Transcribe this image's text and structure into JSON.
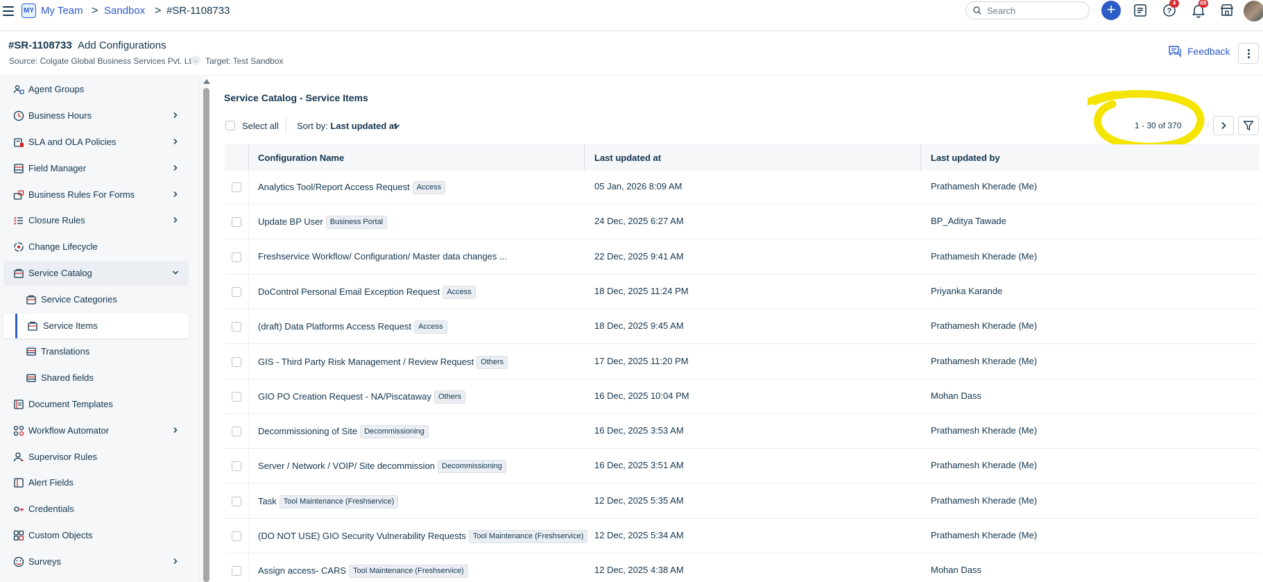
{
  "topbar": {
    "workspace_badge": "MY",
    "breadcrumbs": [
      "My Team",
      "Sandbox",
      "#SR-1108733"
    ],
    "breadcrumb_separator": ">",
    "search_placeholder": "Search",
    "plus_label": "+",
    "help_badge": "4",
    "notifications_badge": "69"
  },
  "subheader": {
    "id": "#SR-1108733",
    "dot": "·",
    "title": "Add Configurations",
    "source": "Source: Colgate Global Business Services Pvt. Ltd.",
    "arrow": "→",
    "target": "Target: Test Sandbox",
    "feedback_label": "Feedback"
  },
  "sidebar": {
    "items": [
      {
        "label": "Agent Groups",
        "icon": "agent-groups-icon",
        "has_chevron": false
      },
      {
        "label": "Business Hours",
        "icon": "clock-icon",
        "has_chevron": true
      },
      {
        "label": "SLA and OLA Policies",
        "icon": "sla-icon",
        "has_chevron": true
      },
      {
        "label": "Field Manager",
        "icon": "field-manager-icon",
        "has_chevron": true
      },
      {
        "label": "Business Rules For Forms",
        "icon": "business-rules-icon",
        "has_chevron": true
      },
      {
        "label": "Closure Rules",
        "icon": "closure-rules-icon",
        "has_chevron": true
      },
      {
        "label": "Change Lifecycle",
        "icon": "change-lifecycle-icon",
        "has_chevron": false
      },
      {
        "label": "Service Catalog",
        "icon": "service-catalog-icon",
        "has_chevron": true,
        "expanded": true
      },
      {
        "label": "Service Categories",
        "icon": "service-categories-icon",
        "has_chevron": false,
        "child": true
      },
      {
        "label": "Service Items",
        "icon": "service-items-icon",
        "has_chevron": false,
        "child": true,
        "active": true
      },
      {
        "label": "Translations",
        "icon": "translations-icon",
        "has_chevron": false,
        "child": true
      },
      {
        "label": "Shared fields",
        "icon": "shared-fields-icon",
        "has_chevron": false,
        "child": true
      },
      {
        "label": "Document Templates",
        "icon": "document-templates-icon",
        "has_chevron": false
      },
      {
        "label": "Workflow Automator",
        "icon": "workflow-icon",
        "has_chevron": true
      },
      {
        "label": "Supervisor Rules",
        "icon": "supervisor-rules-icon",
        "has_chevron": false
      },
      {
        "label": "Alert Fields",
        "icon": "alert-fields-icon",
        "has_chevron": false
      },
      {
        "label": "Credentials",
        "icon": "credentials-icon",
        "has_chevron": false
      },
      {
        "label": "Custom Objects",
        "icon": "custom-objects-icon",
        "has_chevron": false
      },
      {
        "label": "Surveys",
        "icon": "surveys-icon",
        "has_chevron": true
      }
    ]
  },
  "main": {
    "title": "Service Catalog - Service Items",
    "select_all_label": "Select all",
    "sort_prefix": "Sort by:",
    "sort_value": "Last updated at",
    "pagination": "1 - 30 of 370",
    "prev_label": "‹",
    "columns": [
      "Configuration Name",
      "Last updated at",
      "Last updated by"
    ],
    "rows": [
      {
        "name": "Analytics Tool/Report Access Request",
        "tag": "Access",
        "updated_at": "05 Jan, 2026 8:09 AM",
        "updated_by": "Prathamesh Kherade (Me)"
      },
      {
        "name": "Update BP User",
        "tag": "Business Portal",
        "updated_at": "24 Dec, 2025 6:27 AM",
        "updated_by": "BP_Aditya Tawade"
      },
      {
        "name": "Freshservice Workflow/ Configuration/ Master data changes ...",
        "tag": "",
        "updated_at": "22 Dec, 2025 9:41 AM",
        "updated_by": "Prathamesh Kherade (Me)"
      },
      {
        "name": "DoControl Personal Email Exception Request",
        "tag": "Access",
        "updated_at": "18 Dec, 2025 11:24 PM",
        "updated_by": "Priyanka Karande"
      },
      {
        "name": "(draft) Data Platforms Access Request",
        "tag": "Access",
        "updated_at": "18 Dec, 2025 9:45 AM",
        "updated_by": "Prathamesh Kherade (Me)"
      },
      {
        "name": "GIS - Third Party Risk Management / Review Request",
        "tag": "Others",
        "updated_at": "17 Dec, 2025 11:20 PM",
        "updated_by": "Prathamesh Kherade (Me)"
      },
      {
        "name": "GIO PO Creation Request - NA/Piscataway",
        "tag": "Others",
        "updated_at": "16 Dec, 2025 10:04 PM",
        "updated_by": "Mohan Dass"
      },
      {
        "name": "Decommissioning of Site",
        "tag": "Decommissioning",
        "updated_at": "16 Dec, 2025 3:53 AM",
        "updated_by": "Prathamesh Kherade (Me)"
      },
      {
        "name": "Server / Network / VOIP/ Site decommission",
        "tag": "Decommissioning",
        "updated_at": "16 Dec, 2025 3:51 AM",
        "updated_by": "Prathamesh Kherade (Me)"
      },
      {
        "name": "Task",
        "tag": "Tool Maintenance (Freshservice)",
        "updated_at": "12 Dec, 2025 5:35 AM",
        "updated_by": "Prathamesh Kherade (Me)"
      },
      {
        "name": "(DO NOT USE) GIO Security Vulnerability Requests",
        "tag": "Tool Maintenance (Freshservice)",
        "updated_at": "12 Dec, 2025 5:34 AM",
        "updated_by": "Prathamesh Kherade (Me)"
      },
      {
        "name": "Assign access- CARS",
        "tag": "Tool Maintenance (Freshservice)",
        "updated_at": "12 Dec, 2025 4:38 AM",
        "updated_by": "Mohan Dass"
      }
    ]
  },
  "colors": {
    "accent": "#2c5cc5",
    "text": "#12344d",
    "highlight_annotation": "#f5e400",
    "badge": "#d72d30"
  }
}
